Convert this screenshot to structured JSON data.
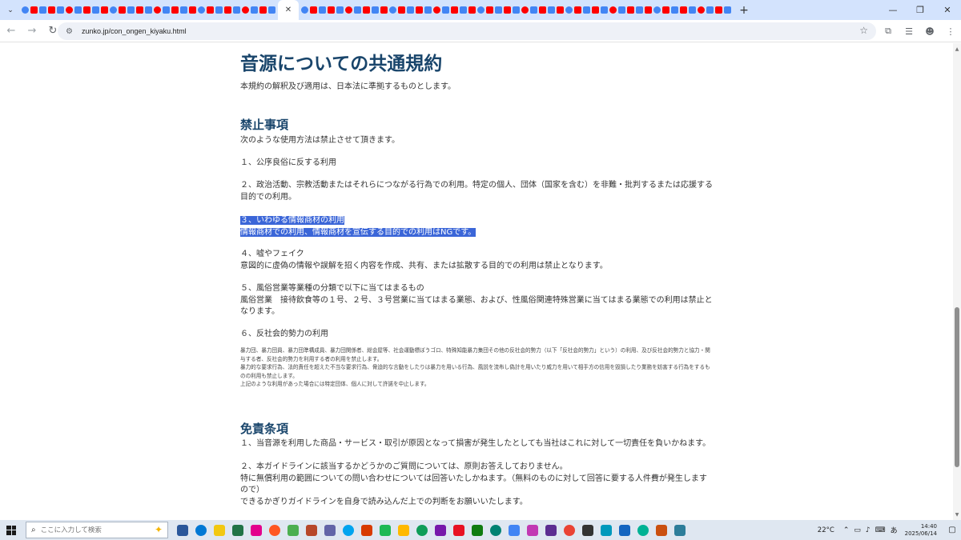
{
  "browser": {
    "active_tab_close": "✕",
    "new_tab": "+",
    "url": "zunko.jp/con_ongen_kiyaku.html",
    "tab_colors": [
      "#4285f4",
      "#d93025",
      "#188038",
      "#f9ab00",
      "#9334e6",
      "#ea4335",
      "#34a853",
      "#ff0000",
      "#5f6368",
      "#1a73e8",
      "#e37400",
      "#000000",
      "#12b5cb",
      "#c5221f"
    ],
    "window_controls": [
      "—",
      "❐",
      "✕"
    ]
  },
  "page": {
    "title": "音源についての共通規約",
    "intro": "本規約の解釈及び適用は、日本法に準拠するものとします。",
    "prohibited": {
      "heading": "禁止事項",
      "lead": "次のような使用方法は禁止させて頂きます。",
      "item1": "１、公序良俗に反する利用",
      "item2": "２、政治活動、宗教活動またはそれらにつながる行為での利用。特定の個人、団体（国家を含む）を非難・批判するまたは応援する目的での利用。",
      "item3_title": "３、いわゆる情報商材の利用",
      "item3_body": "情報商材での利用、情報商材を宣伝する目的での利用はNGです。",
      "item4_title": "４、嘘やフェイク",
      "item4_body": "意図的に虚偽の情報や誤解を招く内容を作成、共有、または拡散する目的での利用は禁止となります。",
      "item5_title": "５、風俗営業等業種の分類で以下に当てはまるもの",
      "item5_body": "風俗営業　接待飲食等の１号、２号、３号営業に当てはまる業態、および、性風俗関連特殊営業に当てはまる業態での利用は禁止となります。",
      "item6_title": "６、反社会的勢力の利用",
      "item6_small1": "暴力団、暴力団員、暴力団準構成員、暴力団関係者、総会屋等、社会運動標ぼうゴロ、特殊知能暴力集団その他の反社会的勢力（以下「反社会的勢力」という）の利用、及び反社会的勢力と協力・関与する者、反社会的勢力を利用する者の利用を禁止します。",
      "item6_small2": "暴力的な要求行為、法的責任を超えた不当な要求行為、脅迫的な言動をしたりは暴力を用いる行為、風説を流布し偽計を用いたり威力を用いて相手方の信用を毀損したり業務を妨害する行為をするものの利用も禁止します。",
      "item6_small3": "上記のような利用があった場合には特定団体、個人に対して許諾を中止します。"
    },
    "disclaimer": {
      "heading": "免責条項",
      "item1": "１、当音源を利用した商品・サービス・取引が原因となって損害が発生したとしても当社はこれに対して一切責任を負いかねます。",
      "item2_title": "２、本ガイドラインに該当するかどうかのご質問については、原則お答えしておりません。",
      "item2_body": "特に無償利用の範囲についての問い合わせについては回答いたしかねます。（無料のものに対して回答に要する人件費が発生しますので）",
      "item2_note": "できるかぎりガイドラインを自身で読み込んだ上での判断をお願いいたします。"
    }
  },
  "taskbar": {
    "search_placeholder": "ここに入力して検索",
    "app_colors": [
      "#2b579a",
      "#0078d4",
      "#f2c811",
      "#217346",
      "#e3008c",
      "#ff5722",
      "#4caf50",
      "#b7472a",
      "#6264a7",
      "#00a4ef",
      "#d83b01",
      "#1db954",
      "#ffb900",
      "#0f9d58",
      "#7719aa",
      "#e81123",
      "#107c10",
      "#008272",
      "#4285f4",
      "#c239b3",
      "#5c2d91",
      "#ea4335",
      "#333333",
      "#0099bc",
      "#1565c0",
      "#00b294",
      "#ca5010",
      "#2d7d9a"
    ],
    "temperature": "22°C",
    "ime": "あ",
    "time": "14:40",
    "date": "2025/06/14"
  }
}
